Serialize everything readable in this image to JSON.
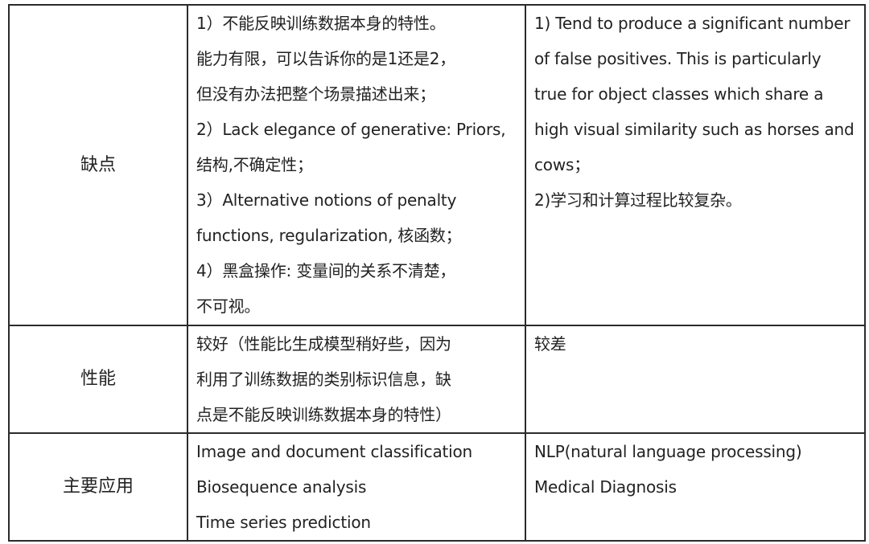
{
  "rows": [
    {
      "label": "缺点",
      "col1": [
        "1）不能反映训练数据本身的特性。",
        "能力有限，可以告诉你的是1还是2，",
        "但没有办法把整个场景描述出来；",
        "2）Lack elegance of generative: Priors,",
        "结构,不确定性；",
        "3）Alternative notions of penalty",
        "functions, regularization, 核函数；",
        "4）黑盒操作: 变量间的关系不清楚，",
        "不可视。"
      ],
      "col2": [
        "1) Tend to produce a significant number",
        "of false positives. This is particularly",
        "true for object classes which share a",
        "high visual similarity such as horses and",
        "cows；",
        "2)学习和计算过程比较复杂。"
      ]
    },
    {
      "label": "性能",
      "col1": [
        "较好（性能比生成模型稍好些，因为",
        "利用了训练数据的类别标识信息，缺",
        "点是不能反映训练数据本身的特性）"
      ],
      "col2": [
        "较差"
      ]
    },
    {
      "label": "主要应用",
      "col1": [
        "Image and document classification",
        "Biosequence analysis",
        "Time series prediction"
      ],
      "col2": [
        "NLP(natural language processing)",
        "Medical Diagnosis"
      ]
    }
  ]
}
